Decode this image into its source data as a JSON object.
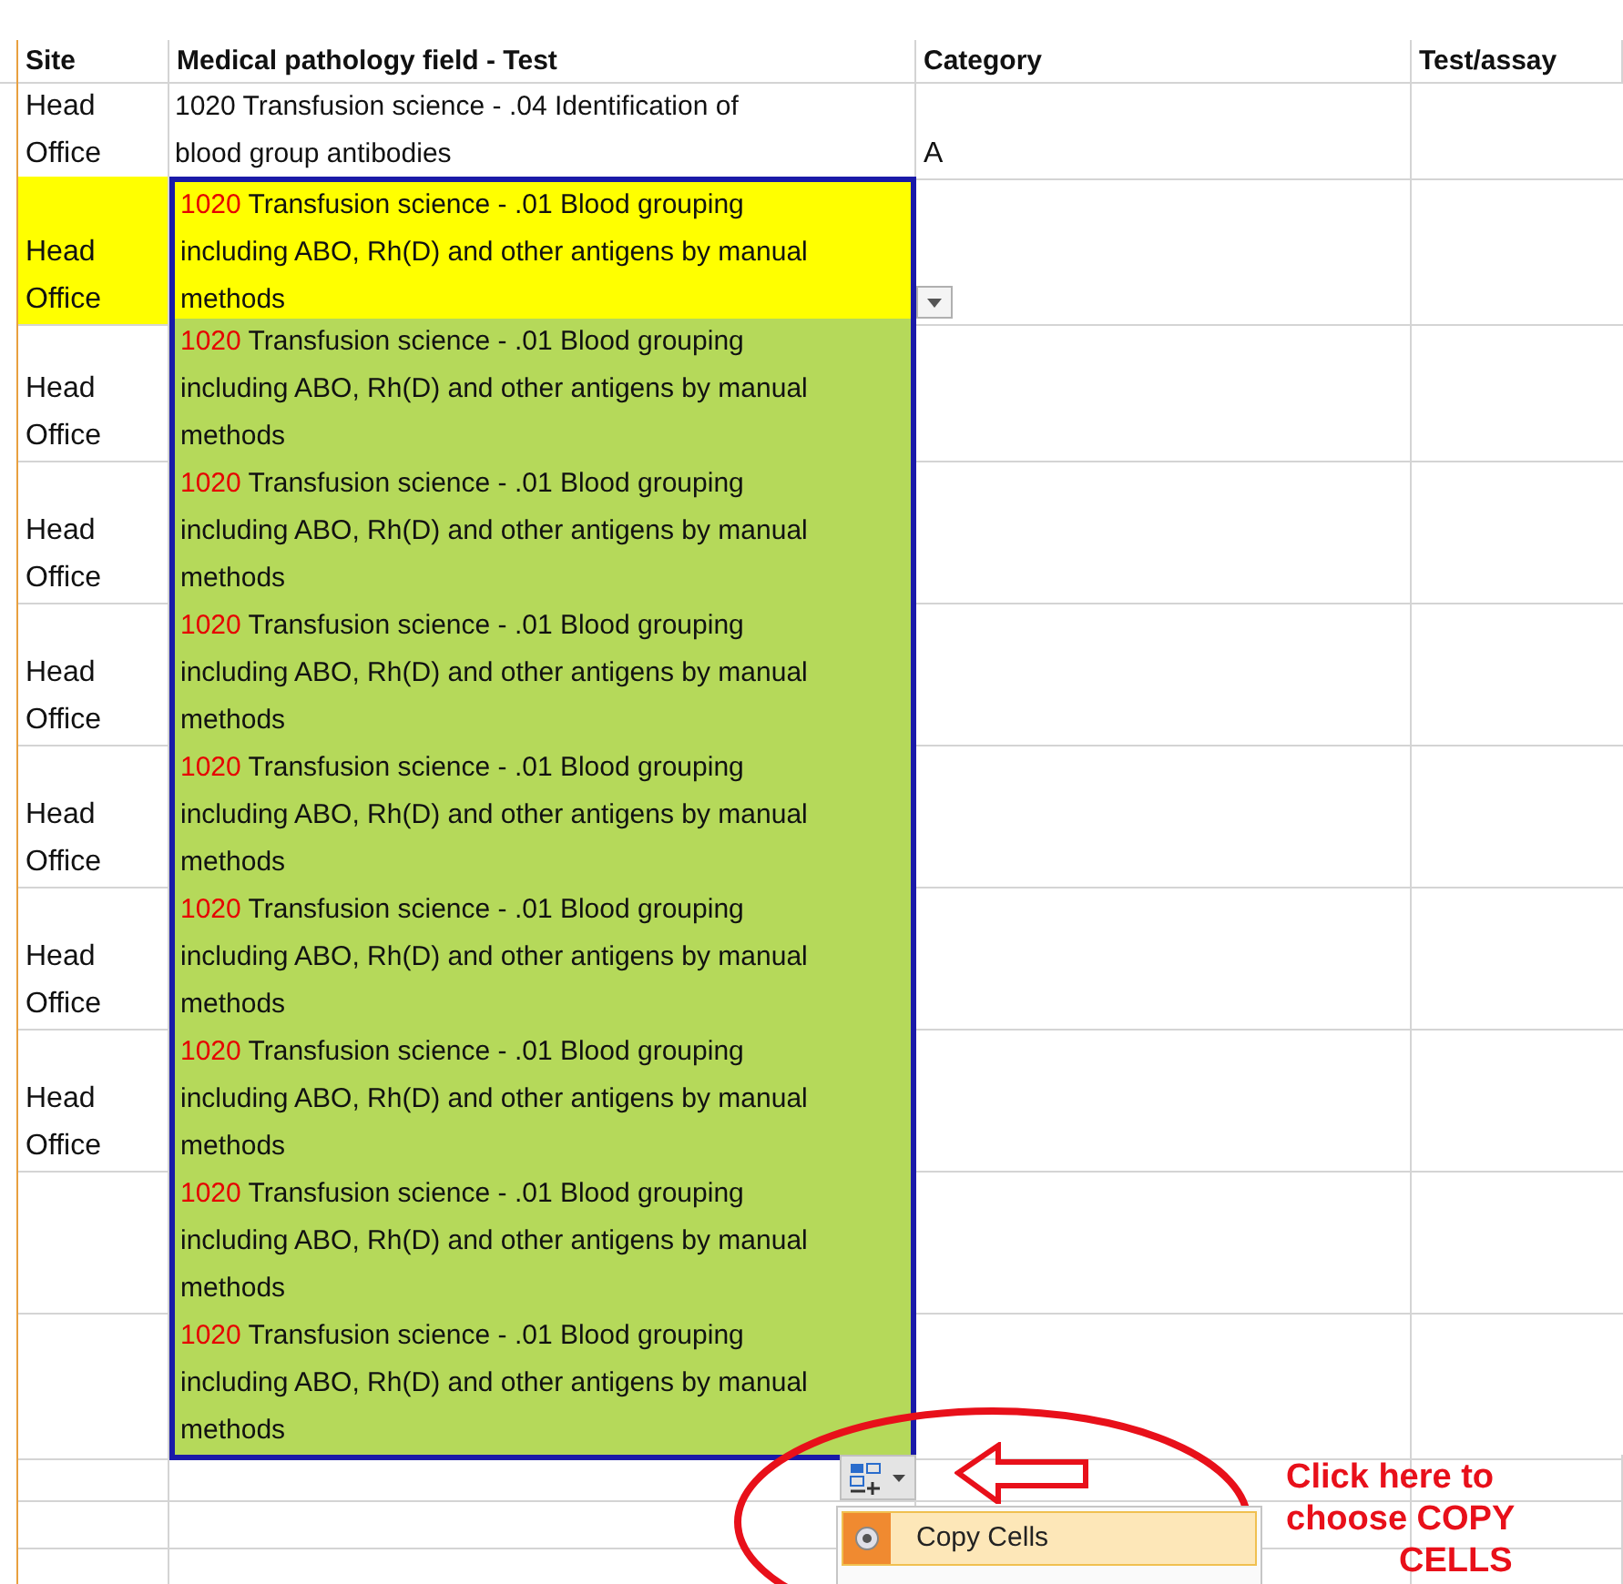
{
  "columns": [
    "Site",
    "Medical pathology field - Test",
    "Category",
    "Test/assay"
  ],
  "rows": [
    {
      "kind": "plain",
      "selected": false,
      "site": "Head Office",
      "code": "1020",
      "test": "Transfusion science - .04 Identification of blood group antibodies",
      "category": "A",
      "dropdown": false
    },
    {
      "kind": "highlighted",
      "selected": true,
      "site": "Head Office",
      "code": "1020",
      "test": "Transfusion science - .01 Blood grouping including ABO, Rh(D) and other antigens by manual methods",
      "dropdown": true
    },
    {
      "kind": "filled",
      "selected": true,
      "site": "Head Office",
      "code": "1020",
      "test": "Transfusion science - .01 Blood grouping including ABO, Rh(D) and other antigens by manual methods",
      "dropdown": false
    },
    {
      "kind": "filled",
      "selected": true,
      "site": "Head Office",
      "code": "1020",
      "test": "Transfusion science - .01 Blood grouping including ABO, Rh(D) and other antigens by manual methods",
      "dropdown": false
    },
    {
      "kind": "filled",
      "selected": true,
      "site": "Head Office",
      "code": "1020",
      "test": "Transfusion science - .01 Blood grouping including ABO, Rh(D) and other antigens by manual methods",
      "dropdown": false
    },
    {
      "kind": "filled",
      "selected": true,
      "site": "Head Office",
      "code": "1020",
      "test": "Transfusion science - .01 Blood grouping including ABO, Rh(D) and other antigens by manual methods",
      "dropdown": false
    },
    {
      "kind": "filled",
      "selected": true,
      "site": "Head Office",
      "code": "1020",
      "test": "Transfusion science - .01 Blood grouping including ABO, Rh(D) and other antigens by manual methods",
      "dropdown": false
    },
    {
      "kind": "filled",
      "selected": true,
      "site": "Head Office",
      "code": "1020",
      "test": "Transfusion science - .01 Blood grouping including ABO, Rh(D) and other antigens by manual methods",
      "dropdown": false
    },
    {
      "kind": "filled",
      "selected": true,
      "code": "1020",
      "test": "Transfusion science - .01 Blood grouping including ABO, Rh(D) and other antigens by manual methods",
      "dropdown": false
    },
    {
      "kind": "filled",
      "selected": true,
      "code": "1020",
      "test": "Transfusion science - .01 Blood grouping including ABO, Rh(D) and other antigens by manual methods",
      "dropdown": false
    }
  ],
  "paste_menu": {
    "items": [
      {
        "label": "Copy Cells",
        "selected": true
      }
    ]
  },
  "annotation": {
    "lines": [
      "Click here to",
      "choose COPY",
      "CELLS"
    ]
  }
}
